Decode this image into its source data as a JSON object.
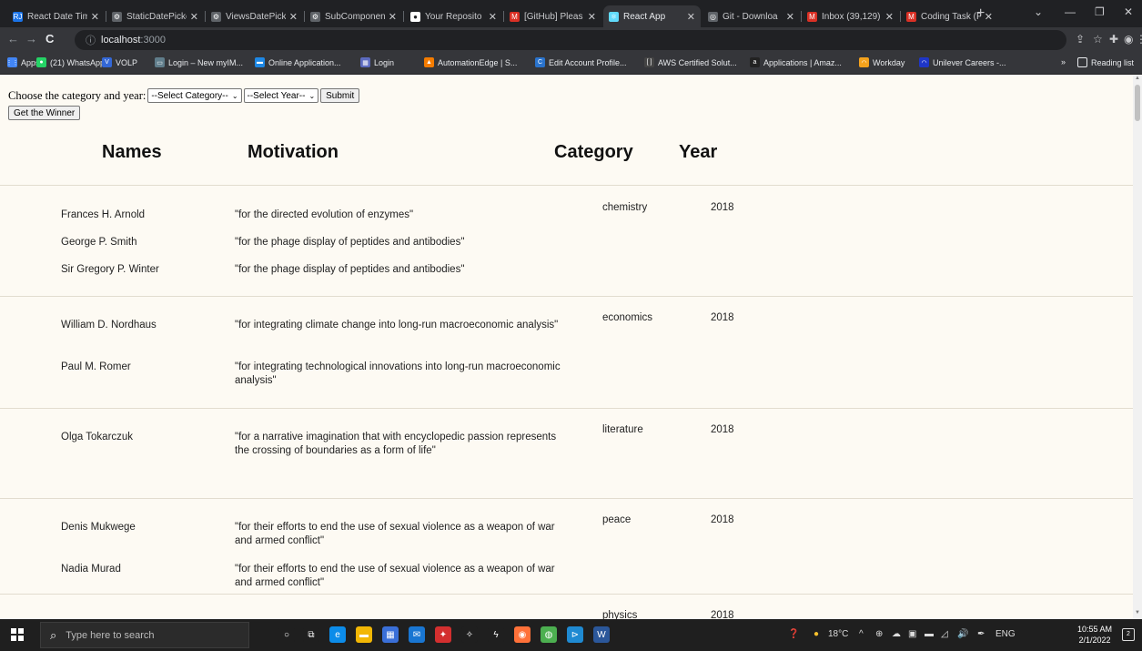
{
  "browser": {
    "tabs": [
      {
        "label": "React Date Tim",
        "icon": "react-date-tab-icon",
        "color": "#1a73e8",
        "glyph": "RJ",
        "active": false
      },
      {
        "label": "StaticDatePicke",
        "icon": "mui-tab-icon",
        "color": "#5f6368",
        "glyph": "⚙",
        "active": false
      },
      {
        "label": "ViewsDatePick",
        "icon": "mui-tab-icon",
        "color": "#5f6368",
        "glyph": "⚙",
        "active": false
      },
      {
        "label": "SubComponen",
        "icon": "mui-tab-icon",
        "color": "#5f6368",
        "glyph": "⚙",
        "active": false
      },
      {
        "label": "Your Reposito",
        "icon": "github-tab-icon",
        "color": "#ffffff",
        "glyph": "●",
        "active": false
      },
      {
        "label": "[GitHub] Pleas",
        "icon": "gmail-tab-icon",
        "color": "#d93025",
        "glyph": "M",
        "active": false
      },
      {
        "label": "React App",
        "icon": "react-tab-icon",
        "color": "#61dafb",
        "glyph": "⚛",
        "active": true
      },
      {
        "label": "Git - Downloa",
        "icon": "git-tab-icon",
        "color": "#5f6368",
        "glyph": "◎",
        "active": false
      },
      {
        "label": "Inbox (39,129)",
        "icon": "gmail-tab-icon",
        "color": "#d93025",
        "glyph": "M",
        "active": false
      },
      {
        "label": "Coding Task (F",
        "icon": "gmail-tab-icon",
        "color": "#d93025",
        "glyph": "M",
        "active": false
      }
    ],
    "new_tab": "+",
    "window_controls": [
      "⌄",
      "—",
      "❐",
      "✕"
    ],
    "url_host": "localhost",
    "url_port": ":3000",
    "nav": {
      "back": "←",
      "forward": "→",
      "reload": "C"
    },
    "bookmarks": [
      {
        "label": "Apps",
        "icon": "apps-icon",
        "color": "#4285f4",
        "glyph": "⋮⋮"
      },
      {
        "label": "(21) WhatsApp",
        "icon": "whatsapp-icon",
        "color": "#25d366",
        "glyph": "●"
      },
      {
        "label": "VOLP",
        "icon": "volp-icon",
        "color": "#3367d6",
        "glyph": "V"
      },
      {
        "label": "Login – New myIM...",
        "icon": "login-icon",
        "color": "#607d8b",
        "glyph": "▭"
      },
      {
        "label": "Online Application...",
        "icon": "application-icon",
        "color": "#1e88e5",
        "glyph": "▬"
      },
      {
        "label": "Login",
        "icon": "login-site-icon",
        "color": "#5c6bc0",
        "glyph": "▦"
      },
      {
        "label": "AutomationEdge | S...",
        "icon": "automationedge-icon",
        "color": "#f57c00",
        "glyph": "▲"
      },
      {
        "label": "Edit Account Profile...",
        "icon": "coursera-icon",
        "color": "#2a73cc",
        "glyph": "C"
      },
      {
        "label": "AWS Certified Solut...",
        "icon": "aws-icon",
        "color": "#444444",
        "glyph": "[ ]"
      },
      {
        "label": "Applications | Amaz...",
        "icon": "amazon-icon",
        "color": "#222222",
        "glyph": "a"
      },
      {
        "label": "Workday",
        "icon": "workday-icon",
        "color": "#f4a21d",
        "glyph": "◠"
      },
      {
        "label": "Unilever Careers -...",
        "icon": "unilever-icon",
        "color": "#1f36c7",
        "glyph": "◠"
      }
    ],
    "more_bookmarks": "»",
    "reading_list": "Reading list"
  },
  "page": {
    "prompt_label": "Choose the category and year:",
    "category_select": "--Select Category--",
    "year_select": "--Select Year--",
    "submit_label": "Submit",
    "winner_label": "Get the Winner",
    "headers": {
      "names": "Names",
      "motivation": "Motivation",
      "category": "Category",
      "year": "Year"
    },
    "groups": [
      {
        "category": "chemistry",
        "year": "2018",
        "laureates": [
          {
            "name": "Frances H. Arnold",
            "motivation": "\"for the directed evolution of enzymes\""
          },
          {
            "name": "George P. Smith",
            "motivation": "\"for the phage display of peptides and antibodies\""
          },
          {
            "name": "Sir Gregory P. Winter",
            "motivation": "\"for the phage display of peptides and antibodies\""
          }
        ]
      },
      {
        "category": "economics",
        "year": "2018",
        "laureates": [
          {
            "name": "William D. Nordhaus",
            "motivation": "\"for integrating climate change into long-run macroeconomic analysis\""
          },
          {
            "name": "Paul M. Romer",
            "motivation": "\"for integrating technological innovations into long-run macroeconomic analysis\""
          }
        ]
      },
      {
        "category": "literature",
        "year": "2018",
        "laureates": [
          {
            "name": "Olga Tokarczuk",
            "motivation": "\"for a narrative imagination that with encyclopedic passion represents the crossing of boundaries as a form of life\""
          }
        ]
      },
      {
        "category": "peace",
        "year": "2018",
        "laureates": [
          {
            "name": "Denis Mukwege",
            "motivation": "\"for their efforts to end the use of sexual violence as a weapon of war and armed conflict\""
          },
          {
            "name": "Nadia Murad",
            "motivation": "\"for their efforts to end the use of sexual violence as a weapon of war and armed conflict\""
          }
        ]
      },
      {
        "category": "physics",
        "year": "2018",
        "laureates": []
      }
    ]
  },
  "taskbar": {
    "search_placeholder": "Type here to search",
    "apps": [
      {
        "icon": "cortana-icon",
        "color": "#1f1f1f",
        "glyph": "○"
      },
      {
        "icon": "task-view-icon",
        "color": "#1f1f1f",
        "glyph": "⧉"
      },
      {
        "icon": "edge-icon",
        "color": "#0c8ce9",
        "glyph": "e"
      },
      {
        "icon": "file-explorer-icon",
        "color": "#f2b705",
        "glyph": "▬"
      },
      {
        "icon": "store-icon",
        "color": "#3a6fd8",
        "glyph": "▦"
      },
      {
        "icon": "mail-icon",
        "color": "#1976d2",
        "glyph": "✉"
      },
      {
        "icon": "app-red-icon",
        "color": "#d32f2f",
        "glyph": "✦"
      },
      {
        "icon": "dropbox-icon",
        "color": "#1f1f1f",
        "glyph": "✧"
      },
      {
        "icon": "winamp-icon",
        "color": "#1f1f1f",
        "glyph": "ϟ"
      },
      {
        "icon": "firefox-icon",
        "color": "#ff7139",
        "glyph": "◉"
      },
      {
        "icon": "chrome-icon",
        "color": "#4caf50",
        "glyph": "◍"
      },
      {
        "icon": "vscode-icon",
        "color": "#1f8ad2",
        "glyph": "⊳"
      },
      {
        "icon": "word-icon",
        "color": "#2b579a",
        "glyph": "W"
      }
    ],
    "weather": "18°C",
    "language": "ENG",
    "time": "10:55 AM",
    "date": "2/1/2022",
    "notification_count": "2"
  }
}
